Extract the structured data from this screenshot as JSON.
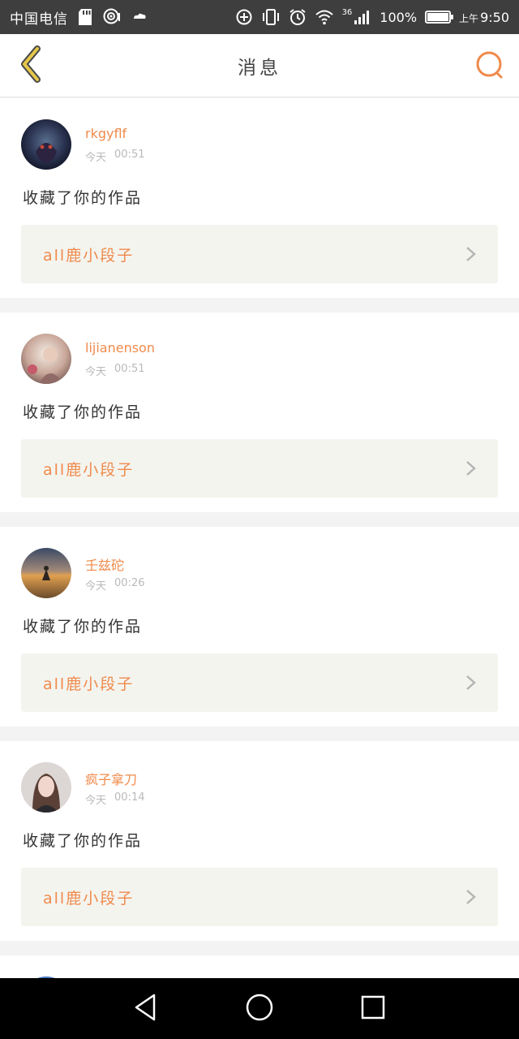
{
  "status_bar": {
    "carrier": "中国电信",
    "network_type": "36",
    "battery_percent": "100%",
    "time_prefix": "上午",
    "time": "9:50",
    "icons": [
      "sd-card-icon",
      "hotspot-icon",
      "cloud-icon",
      "data-saver-icon",
      "vibrate-icon",
      "alarm-icon",
      "wifi-icon",
      "signal-icon",
      "battery-icon"
    ]
  },
  "header": {
    "title": "消息",
    "back_icon": "chevron-left-icon",
    "search_icon": "search-icon",
    "accent_color": "#f08a4b",
    "back_color": "#e6c84a"
  },
  "messages": [
    {
      "username": "rkgyflf",
      "day": "今天",
      "time": "00:51",
      "action": "收藏了你的作品",
      "work_title": "all鹿小段子"
    },
    {
      "username": "lijianenson",
      "day": "今天",
      "time": "00:51",
      "action": "收藏了你的作品",
      "work_title": "all鹿小段子"
    },
    {
      "username": "壬兹砣",
      "day": "今天",
      "time": "00:26",
      "action": "收藏了你的作品",
      "work_title": "all鹿小段子"
    },
    {
      "username": "疯子拿刀",
      "day": "今天",
      "time": "00:14",
      "action": "收藏了你的作品",
      "work_title": "all鹿小段子"
    }
  ],
  "nav_bar": {
    "icons": [
      "back-triangle-icon",
      "home-circle-icon",
      "recents-square-icon"
    ]
  }
}
